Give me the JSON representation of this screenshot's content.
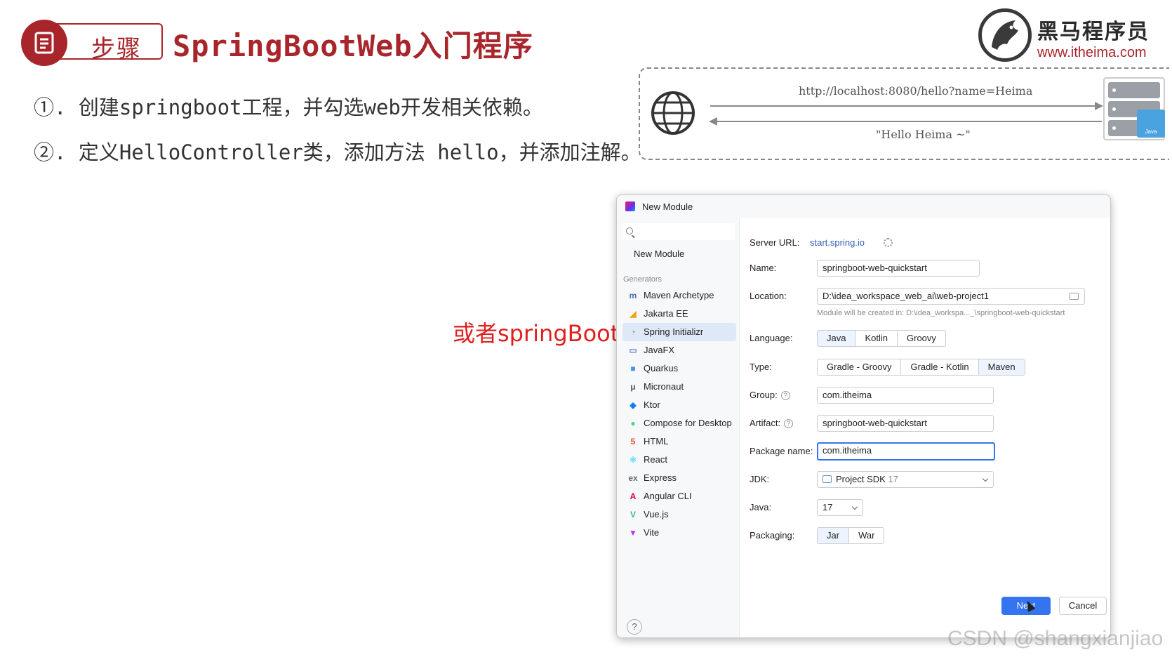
{
  "slide": {
    "badge_label": "步骤",
    "title": "SpringBootWeb入门程序",
    "steps": [
      "①. 创建springboot工程，并勾选web开发相关依赖。",
      "②. 定义HelloController类，添加方法 hello，并添加注解。"
    ],
    "brand_name": "黑马程序员",
    "brand_url": "www.itheima.com",
    "hint": "或者springBoot",
    "watermark": "CSDN @shangxianjiao"
  },
  "diagram": {
    "request_url": "http://localhost:8080/hello?name=Heima",
    "response": "\"Hello Heima ~\"",
    "server_folder_label": "Java"
  },
  "dialog": {
    "title": "New Module",
    "sidebar": {
      "new_module": "New Module",
      "generators_heading": "Generators",
      "items": [
        {
          "label": "Maven Archetype",
          "icon": "maven-icon",
          "glyph": "m",
          "color": "#4a6fb5"
        },
        {
          "label": "Jakarta EE",
          "icon": "jakarta-icon",
          "glyph": "◢",
          "color": "#f0a30a"
        },
        {
          "label": "Spring Initializr",
          "icon": "spring-icon",
          "glyph": "◔",
          "color": "#6db33f",
          "selected": true
        },
        {
          "label": "JavaFX",
          "icon": "javafx-icon",
          "glyph": "▭",
          "color": "#5a7fc8"
        },
        {
          "label": "Quarkus",
          "icon": "quarkus-icon",
          "glyph": "■",
          "color": "#4695eb"
        },
        {
          "label": "Micronaut",
          "icon": "micronaut-icon",
          "glyph": "μ",
          "color": "#555555"
        },
        {
          "label": "Ktor",
          "icon": "ktor-icon",
          "glyph": "◆",
          "color": "#087cfa"
        },
        {
          "label": "Compose for Desktop",
          "icon": "compose-icon",
          "glyph": "●",
          "color": "#3ddc84"
        },
        {
          "label": "HTML",
          "icon": "html-icon",
          "glyph": "5",
          "color": "#e44d26"
        },
        {
          "label": "React",
          "icon": "react-icon",
          "glyph": "⚛",
          "color": "#61dafb"
        },
        {
          "label": "Express",
          "icon": "express-icon",
          "glyph": "ex",
          "color": "#666666"
        },
        {
          "label": "Angular CLI",
          "icon": "angular-icon",
          "glyph": "A",
          "color": "#dd0031"
        },
        {
          "label": "Vue.js",
          "icon": "vue-icon",
          "glyph": "V",
          "color": "#41b883"
        },
        {
          "label": "Vite",
          "icon": "vite-icon",
          "glyph": "▼",
          "color": "#bd34fe"
        }
      ]
    },
    "form": {
      "server_url_label": "Server URL:",
      "server_url": "start.spring.io",
      "name_label": "Name:",
      "name": "springboot-web-quickstart",
      "location_label": "Location:",
      "location": "D:\\idea_workspace_web_ai\\web-project1",
      "location_note": "Module will be created in: D:\\idea_workspa..._\\springboot-web-quickstart",
      "language_label": "Language:",
      "languages": [
        "Java",
        "Kotlin",
        "Groovy"
      ],
      "type_label": "Type:",
      "types": [
        "Gradle - Groovy",
        "Gradle - Kotlin",
        "Maven"
      ],
      "group_label": "Group:",
      "group": "com.itheima",
      "artifact_label": "Artifact:",
      "artifact": "springboot-web-quickstart",
      "package_label": "Package name:",
      "package": "com.itheima",
      "jdk_label": "JDK:",
      "jdk_name": "Project SDK",
      "jdk_version": "17",
      "java_label": "Java:",
      "java_version": "17",
      "packaging_label": "Packaging:",
      "packagings": [
        "Jar",
        "War"
      ]
    },
    "buttons": {
      "help": "?",
      "next": "Next",
      "cancel": "Cancel"
    }
  }
}
